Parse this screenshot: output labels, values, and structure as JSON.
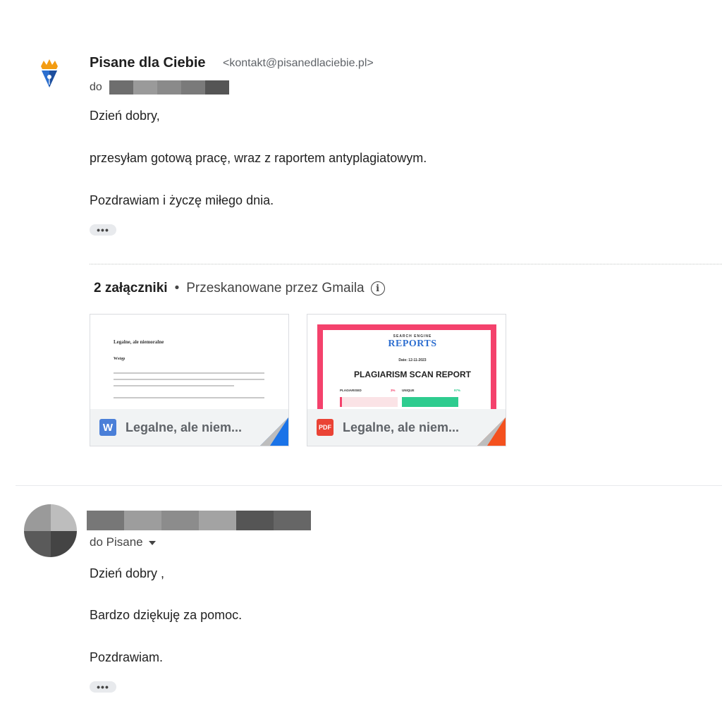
{
  "message1": {
    "sender_name": "Pisane dla Ciebie",
    "sender_email": "<kontakt@pisanedlaciebie.pl>",
    "to_prefix": "do",
    "body": [
      "Dzień dobry,",
      "przesyłam gotową pracę, wraz z raportem antyplagiatowym.",
      "Pozdrawiam i życzę miłego dnia."
    ],
    "more_label": "•••"
  },
  "attachments": {
    "count_label": "2 załączniki",
    "bullet": "•",
    "scan_label": "Przeskanowane przez Gmaila",
    "info_icon": "i",
    "items": [
      {
        "icon": "W",
        "name": "Legalne, ale niem...",
        "type": "word",
        "preview": {
          "title": "Legalne, ale niemoralne",
          "heading": "Wstęp"
        }
      },
      {
        "icon": "PDF",
        "name": "Legalne, ale niem...",
        "type": "pdf",
        "preview": {
          "logo_top": "SEARCH ENGINE",
          "logo": "REPORTS",
          "date": "Date: 12-11-2023",
          "title": "PLAGIARISM SCAN REPORT",
          "plagiarised_label": "PLAGIARISED",
          "plagiarised_value": "3%",
          "unique_label": "UNIQUE",
          "unique_value": "97%"
        }
      }
    ]
  },
  "message2": {
    "to_label": "do Pisane",
    "body": [
      "Dzień dobry ,",
      "Bardzo dziękuję za pomoc.",
      "Pozdrawiam."
    ],
    "more_label": "•••"
  },
  "colors": {
    "word_blue": "#4a7fd8",
    "pdf_red": "#ea4335",
    "pdf_frame_pink": "#f4426c",
    "unique_green": "#2ecc8f"
  }
}
